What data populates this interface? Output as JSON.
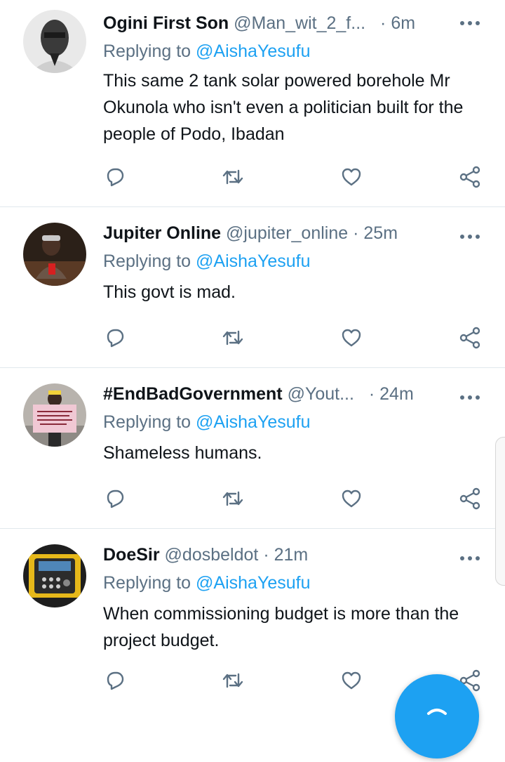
{
  "tweets": [
    {
      "name": "Ogini First Son",
      "handle": "@Man_wit_2_f...",
      "time": "· 6m",
      "replying_label": "Replying to",
      "replying_to": "@AishaYesufu",
      "text": "This same 2 tank solar powered borehole Mr Okunola who isn't even a politician built for the people of Podo, Ibadan"
    },
    {
      "name": "Jupiter Online",
      "handle": "@jupiter_online",
      "time": "· 25m",
      "replying_label": "Replying to",
      "replying_to": "@AishaYesufu",
      "text": "This govt is mad."
    },
    {
      "name": "#EndBadGovernment",
      "handle": "@Yout...",
      "time": "· 24m",
      "replying_label": "Replying to",
      "replying_to": "@AishaYesufu",
      "text": "Shameless humans."
    },
    {
      "name": "DoeSir",
      "handle": "@dosbeldot",
      "time": "· 21m",
      "replying_label": "Replying to",
      "replying_to": "@AishaYesufu",
      "text": "When commissioning budget is more than the project budget."
    }
  ],
  "colors": {
    "accent": "#1da1f2",
    "secondary_text": "#5b7083",
    "primary_text": "#0f1419",
    "divider": "#e1e8ed"
  },
  "icons": {
    "reply": "reply-icon",
    "retweet": "retweet-icon",
    "like": "like-icon",
    "share": "share-icon",
    "more": "more-icon",
    "compose": "compose-icon"
  }
}
